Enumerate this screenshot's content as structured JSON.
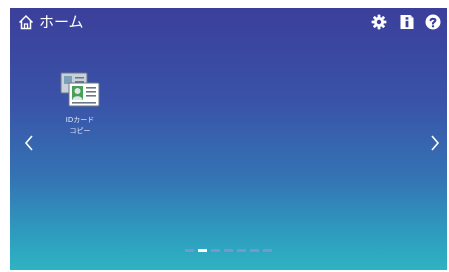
{
  "header": {
    "title": "ホーム",
    "icons": [
      "home-icon",
      "gear-icon",
      "info-icon",
      "help-icon"
    ]
  },
  "apps": [
    {
      "label": "IDカード\nコピー",
      "icon": "id-card-icon"
    }
  ],
  "navigation": {
    "left_icon": "chevron-left-icon",
    "right_icon": "chevron-right-icon"
  },
  "pager": {
    "pages": 7,
    "current": 2
  },
  "colors": {
    "bg_top": "#3b3f9a",
    "bg_bottom": "#2fb3c2",
    "accent": "#ffffff"
  }
}
